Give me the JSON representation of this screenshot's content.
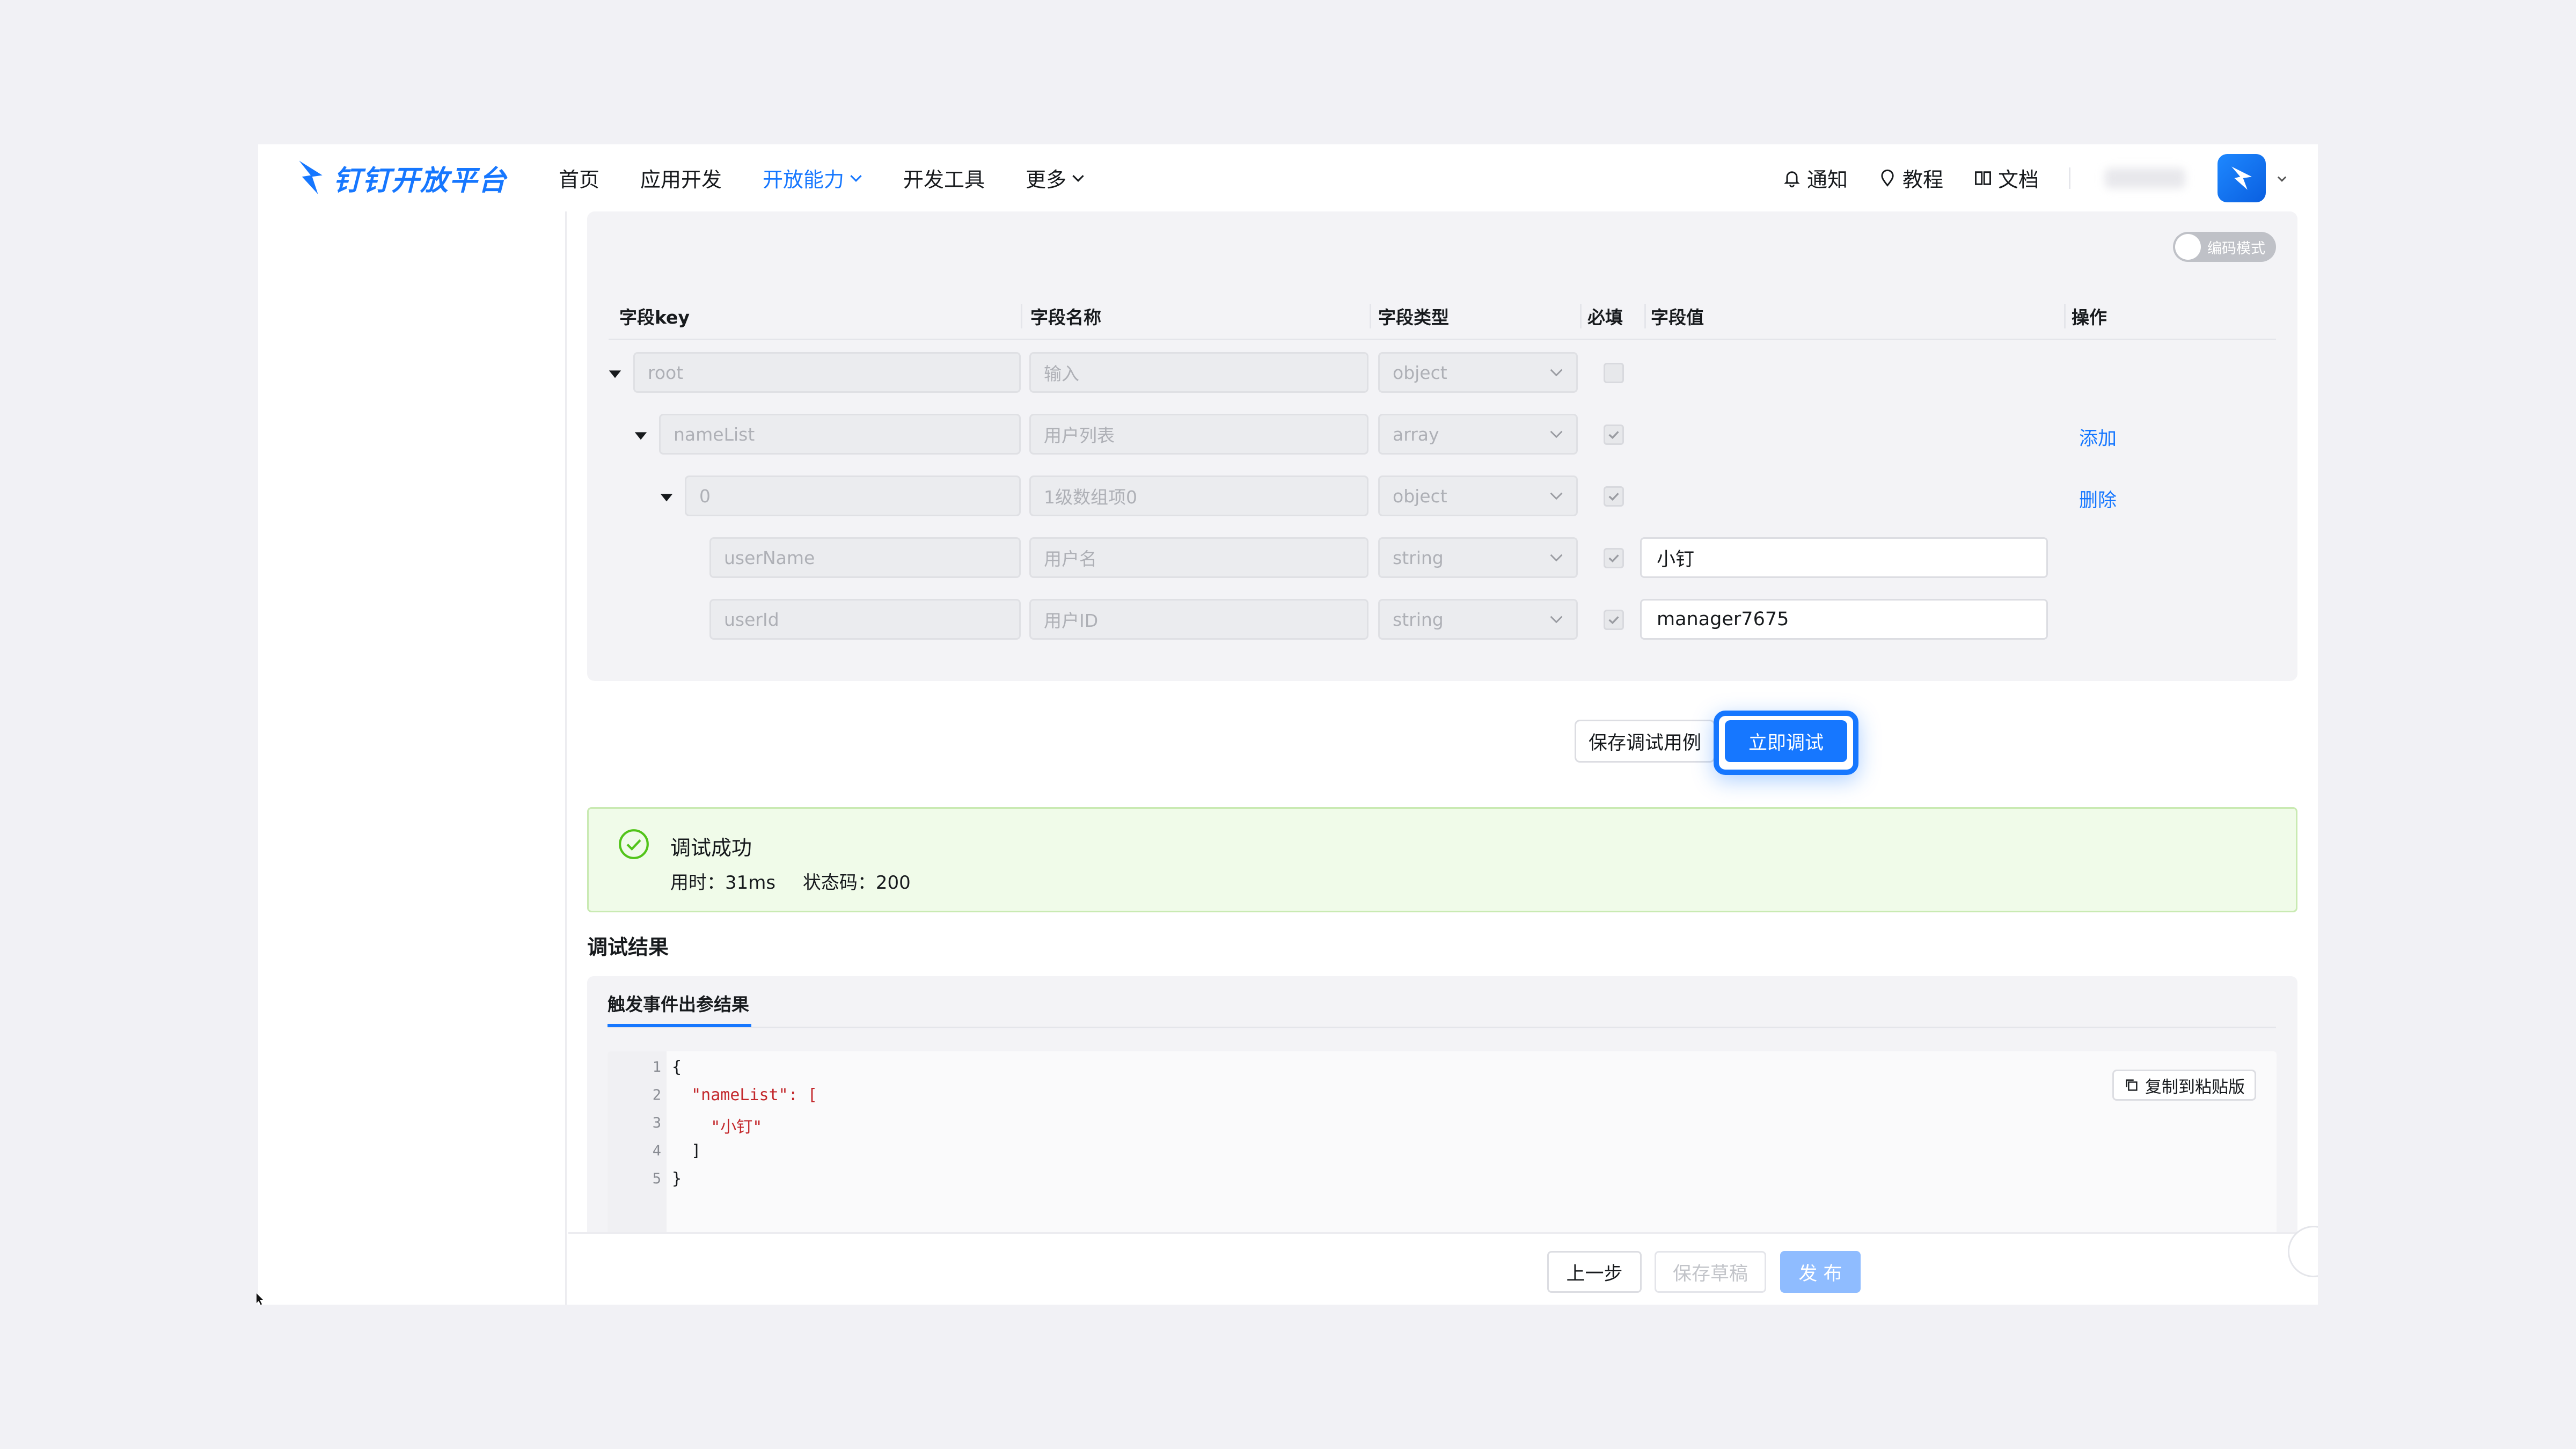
{
  "brand": {
    "name": "钉钉开放平台"
  },
  "nav": {
    "items": [
      {
        "label": "首页",
        "active": false,
        "dropdown": false
      },
      {
        "label": "应用开发",
        "active": false,
        "dropdown": false
      },
      {
        "label": "开放能力",
        "active": true,
        "dropdown": true
      },
      {
        "label": "开发工具",
        "active": false,
        "dropdown": false
      },
      {
        "label": "更多",
        "active": false,
        "dropdown": true
      }
    ],
    "right": {
      "notify": "通知",
      "tutorial": "教程",
      "docs": "文档"
    }
  },
  "editor": {
    "mode_toggle": "编码模式",
    "headers": {
      "key": "字段key",
      "name": "字段名称",
      "type": "字段类型",
      "required": "必填",
      "value": "字段值",
      "ops": "操作"
    },
    "rows": [
      {
        "key": "root",
        "name_placeholder": "输入",
        "type": "object",
        "required": false,
        "value": "",
        "op": ""
      },
      {
        "key": "nameList",
        "name": "用户列表",
        "type": "array",
        "required": true,
        "value": "",
        "op": "添加"
      },
      {
        "key": "0",
        "name": "1级数组项0",
        "type": "object",
        "required": true,
        "value": "",
        "op": "删除"
      },
      {
        "key": "userName",
        "name": "用户名",
        "type": "string",
        "required": true,
        "value": "小钉",
        "op": ""
      },
      {
        "key": "userId",
        "name": "用户ID",
        "type": "string",
        "required": true,
        "value": "manager7675",
        "op": ""
      }
    ]
  },
  "actions": {
    "save_case": "保存调试用例",
    "run_now": "立即调试"
  },
  "result_status": {
    "title": "调试成功",
    "time": "用时：31ms",
    "code": "状态码：200",
    "color": "#52c41a"
  },
  "results": {
    "title": "调试结果",
    "tab": "触发事件出参结果",
    "copy": "复制到粘贴版",
    "lines": [
      {
        "n": "1",
        "text": "{"
      },
      {
        "n": "2",
        "text": "  \"nameList\": ["
      },
      {
        "n": "3",
        "text": "    \"小钉\""
      },
      {
        "n": "4",
        "text": "  ]"
      },
      {
        "n": "5",
        "text": "}"
      }
    ]
  },
  "footer": {
    "prev": "上一步",
    "draft": "保存草稿",
    "publish": "发 布"
  },
  "colors": {
    "primary": "#1677ff",
    "success_bg": "#f0fbe9"
  }
}
